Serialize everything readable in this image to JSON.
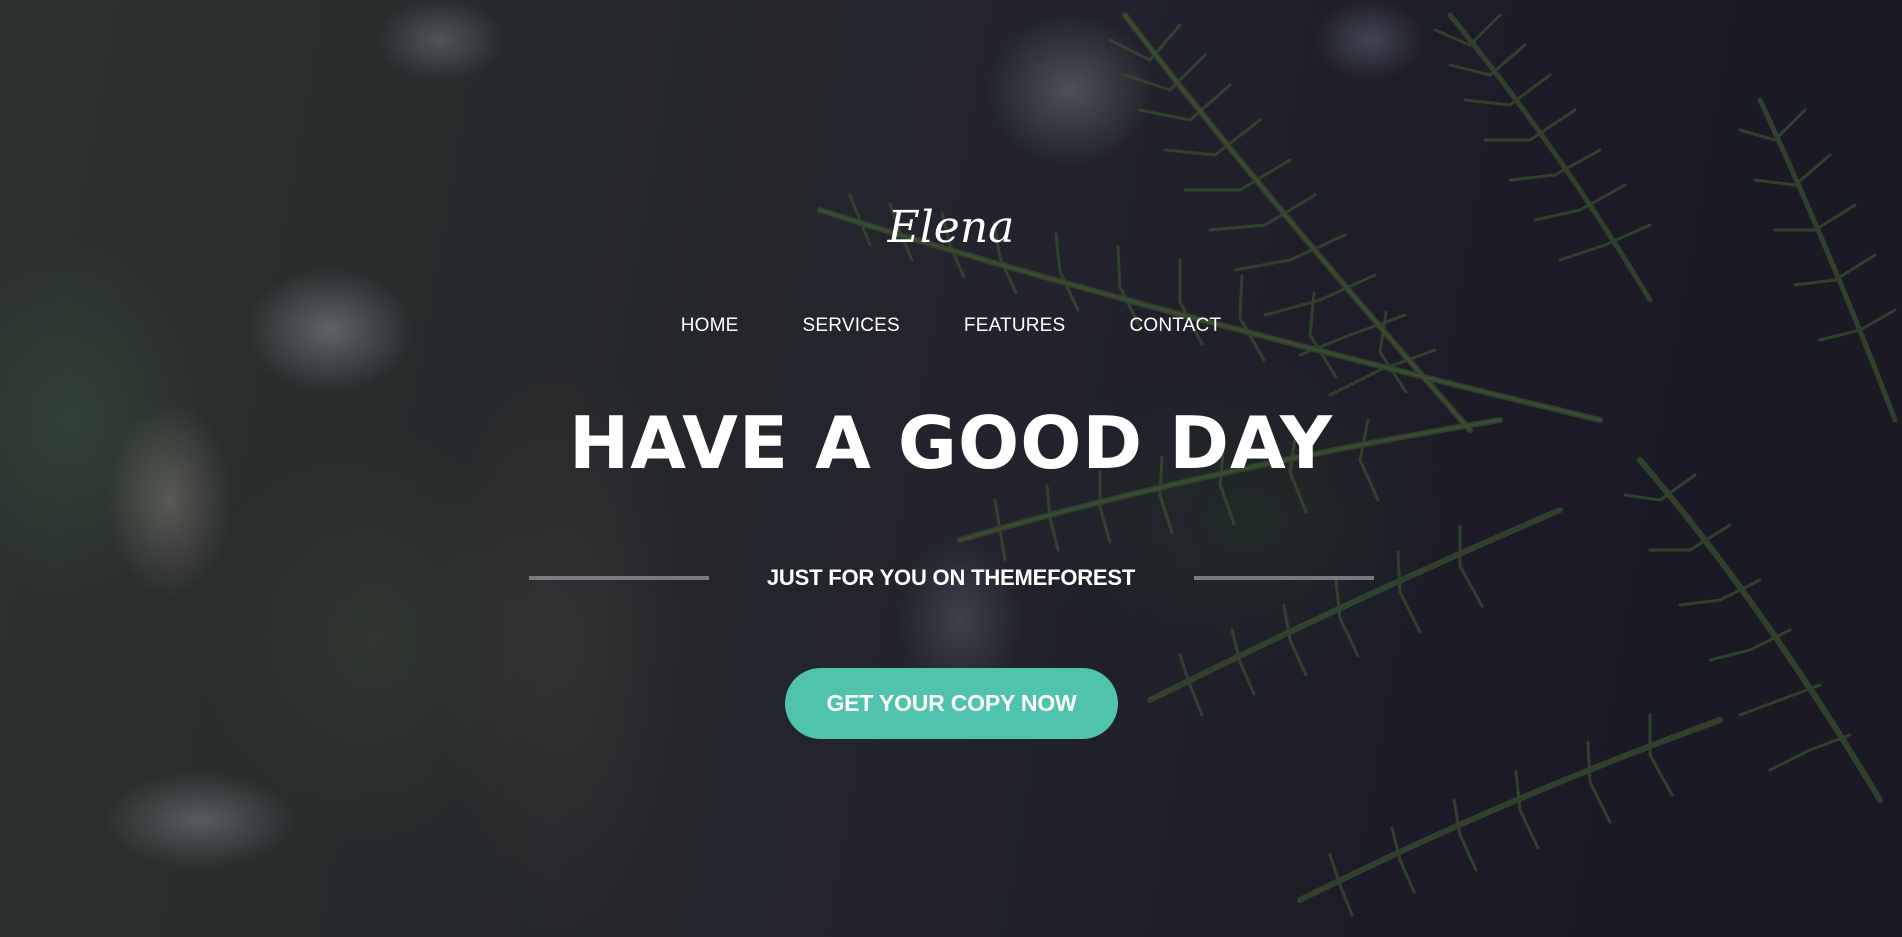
{
  "brand": {
    "logo_text": "Elena"
  },
  "nav": {
    "items": [
      {
        "label": "HOME"
      },
      {
        "label": "SERVICES"
      },
      {
        "label": "FEATURES"
      },
      {
        "label": "CONTACT"
      }
    ]
  },
  "hero": {
    "headline": "HAVE A GOOD DAY",
    "subheadline": "JUST FOR YOU ON THEMEFOREST",
    "cta_label": "GET YOUR COPY NOW"
  },
  "colors": {
    "accent": "#4fc3ab",
    "text": "#ffffff",
    "background_dark": "#1c1a26"
  }
}
